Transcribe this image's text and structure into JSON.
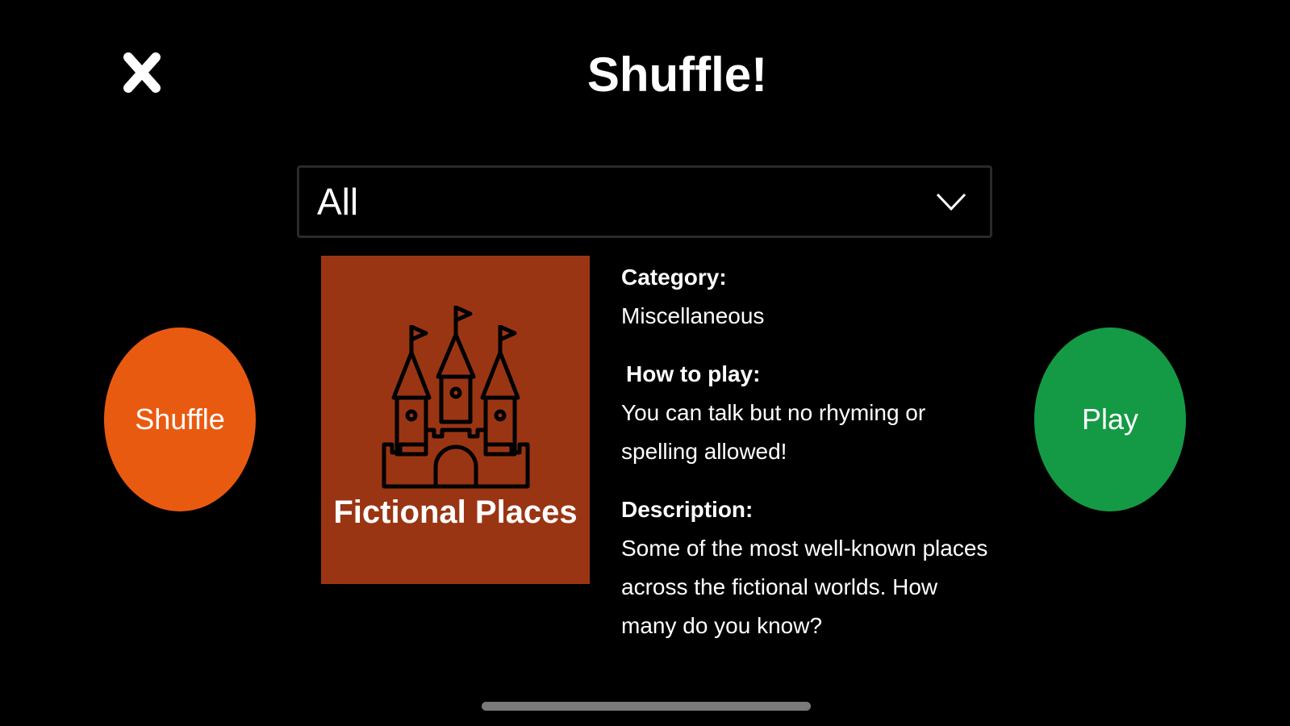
{
  "header": {
    "title": "Shuffle!",
    "close_icon": "close-icon"
  },
  "filter": {
    "selected": "All",
    "chevron_icon": "chevron-down-icon"
  },
  "buttons": {
    "shuffle_label": "Shuffle",
    "play_label": "Play"
  },
  "card": {
    "title": "Fictional Places",
    "icon": "castle-icon"
  },
  "info": {
    "category_label": "Category:",
    "category_value": "Miscellaneous",
    "howto_label": "How to play:",
    "howto_value": "You can talk but no rhyming or spelling allowed!",
    "description_label": "Description:",
    "description_value": "Some of the most well-known places across the fictional worlds. How many do you know?"
  },
  "colors": {
    "background": "#000000",
    "shuffle_button": "#E95A11",
    "play_button": "#149A45",
    "card_background": "#9A3514",
    "text": "#FFFFFF"
  }
}
